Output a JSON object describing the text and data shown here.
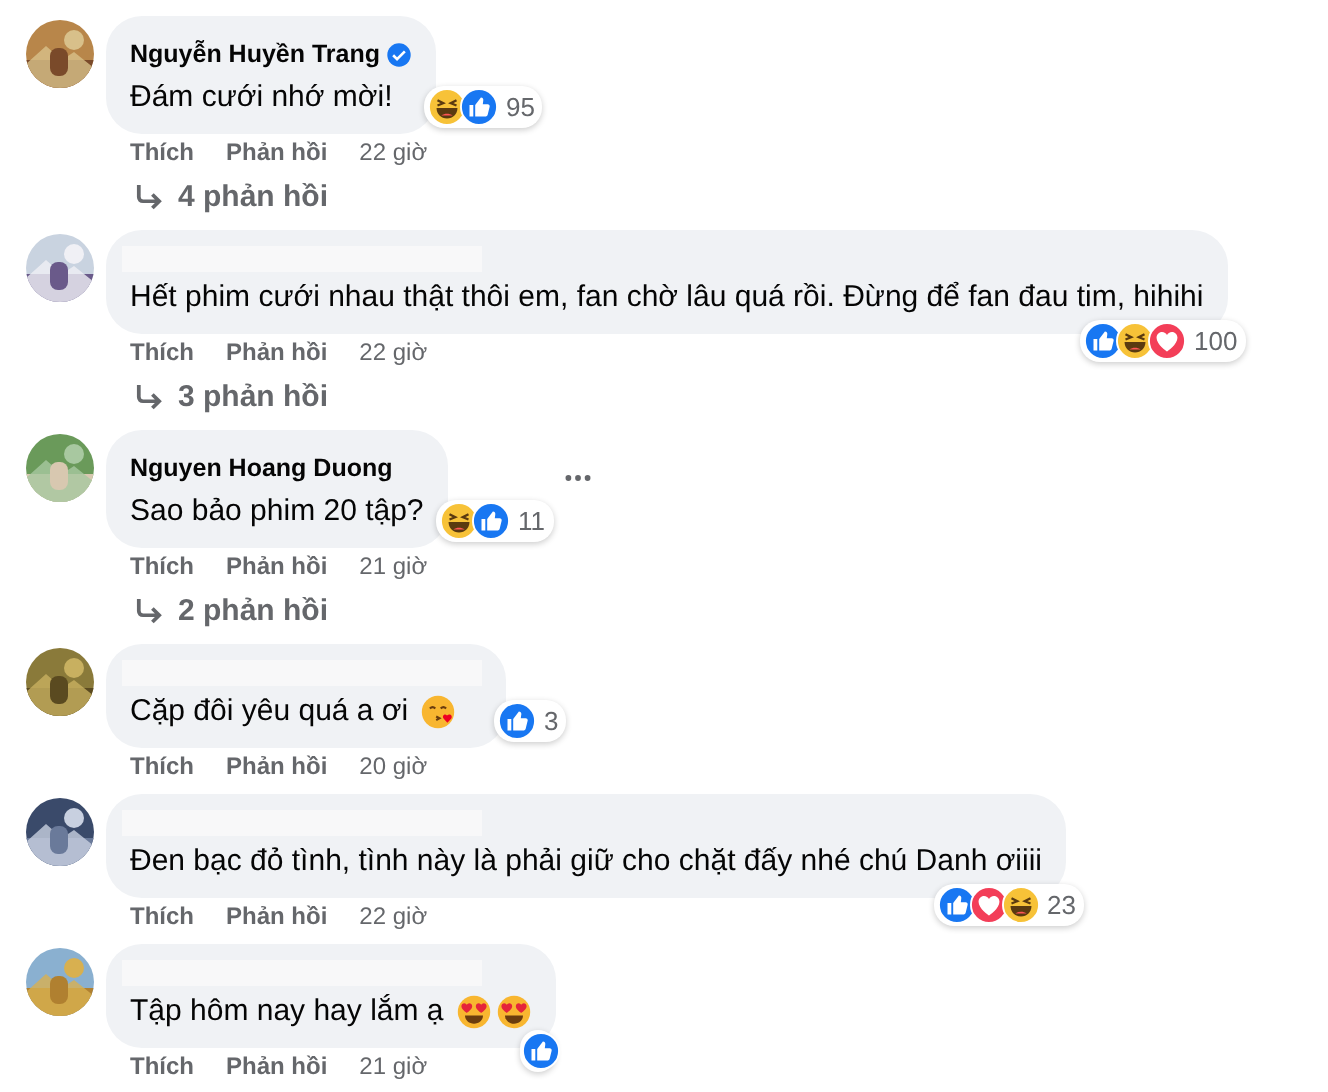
{
  "comments": [
    {
      "author": "Nguyễn Huyền Trang",
      "verified": true,
      "text": "Đám cưới nhớ mời!",
      "reactions": [
        {
          "kind": "haha"
        },
        {
          "kind": "like"
        }
      ],
      "reaction_count": "95",
      "actions": [
        "Thích",
        "Phản hồi"
      ],
      "time": "22 giờ",
      "replies": "4 phản hồi"
    },
    {
      "author_hidden": true,
      "text": "Hết phim cưới nhau thật thôi em, fan chờ lâu quá rồi. Đừng để fan đau tim, hihihi",
      "reactions": [
        {
          "kind": "like"
        },
        {
          "kind": "haha"
        },
        {
          "kind": "love"
        }
      ],
      "reaction_count": "100",
      "actions": [
        "Thích",
        "Phản hồi"
      ],
      "time": "22 giờ",
      "replies": "3 phản hồi"
    },
    {
      "author": "Nguyen Hoang Duong",
      "text": "Sao bảo phim 20 tập?",
      "reactions": [
        {
          "kind": "haha"
        },
        {
          "kind": "like"
        }
      ],
      "reaction_count": "11",
      "actions": [
        "Thích",
        "Phản hồi"
      ],
      "time": "21 giờ",
      "replies": "2 phản hồi",
      "more_menu": true
    },
    {
      "author_hidden": true,
      "text": "Cặp đôi yêu quá a ơi",
      "emojis": [
        {
          "kind": "kiss"
        }
      ],
      "reactions": [
        {
          "kind": "like"
        }
      ],
      "reaction_count": "3",
      "actions": [
        "Thích",
        "Phản hồi"
      ],
      "time": "20 giờ"
    },
    {
      "author_hidden": true,
      "text": "Đen bạc đỏ tình, tình này là phải giữ cho chặt đấy nhé chú Danh ơiiii",
      "reactions": [
        {
          "kind": "like"
        },
        {
          "kind": "love"
        },
        {
          "kind": "haha"
        }
      ],
      "reaction_count": "23",
      "actions": [
        "Thích",
        "Phản hồi"
      ],
      "time": "22 giờ"
    },
    {
      "author_hidden": true,
      "text": "Tập hôm nay hay lắm ạ",
      "emojis": [
        {
          "kind": "heart-eyes"
        },
        {
          "kind": "heart-eyes"
        }
      ],
      "reactions": [
        {
          "kind": "like"
        }
      ],
      "actions": [
        "Thích",
        "Phản hồi"
      ],
      "time": "21 giờ"
    }
  ]
}
